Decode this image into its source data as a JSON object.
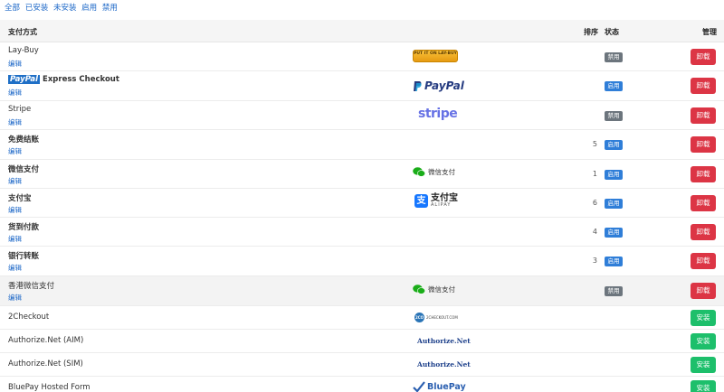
{
  "filters": [
    "全部",
    "已安装",
    "未安装",
    "启用",
    "禁用"
  ],
  "header": {
    "method": "支付方式",
    "order": "排序",
    "status": "状态",
    "manage": "管理"
  },
  "edit_label": "编辑",
  "rows": [
    {
      "name": "Lay-Buy",
      "logo": "PUT IT ON LAY-BUY",
      "order": "",
      "status": "禁用",
      "action": "卸载"
    },
    {
      "name": "Express Checkout",
      "name_tag": "PayPal",
      "logo": "PayPal",
      "order": "",
      "status": "启用",
      "action": "卸载"
    },
    {
      "name": "Stripe",
      "logo": "stripe",
      "order": "",
      "status": "禁用",
      "action": "卸载"
    },
    {
      "name": "免费结账",
      "logo": "",
      "order": "5",
      "status": "启用",
      "action": "卸载"
    },
    {
      "name": "微信支付",
      "logo": "微信支付",
      "order": "1",
      "status": "启用",
      "action": "卸载"
    },
    {
      "name": "支付宝",
      "logo": "支付宝",
      "logo_sub": "ALIPAY",
      "order": "6",
      "status": "启用",
      "action": "卸载"
    },
    {
      "name": "货到付款",
      "logo": "",
      "order": "4",
      "status": "启用",
      "action": "卸载"
    },
    {
      "name": "银行转账",
      "logo": "",
      "order": "3",
      "status": "启用",
      "action": "卸载"
    },
    {
      "name": "香港微信支付",
      "logo": "微信支付",
      "order": "",
      "status": "禁用",
      "action": "卸载"
    },
    {
      "name": "2Checkout",
      "logo": "2CO",
      "logo_sub": "2CHECKOUT.COM",
      "action": "安装"
    },
    {
      "name": "Authorize.Net (AIM)",
      "logo": "Authorize.Net",
      "action": "安装"
    },
    {
      "name": "Authorize.Net (SIM)",
      "logo": "Authorize.Net",
      "action": "安装"
    },
    {
      "name": "BluePay Hosted Form",
      "logo": "BluePay",
      "action": "安装"
    }
  ],
  "colors": {
    "link": "#1a66c7",
    "danger": "#dc3545",
    "success": "#1dbf6b",
    "enabled": "#2f7ed8",
    "disabled": "#6c757d"
  }
}
